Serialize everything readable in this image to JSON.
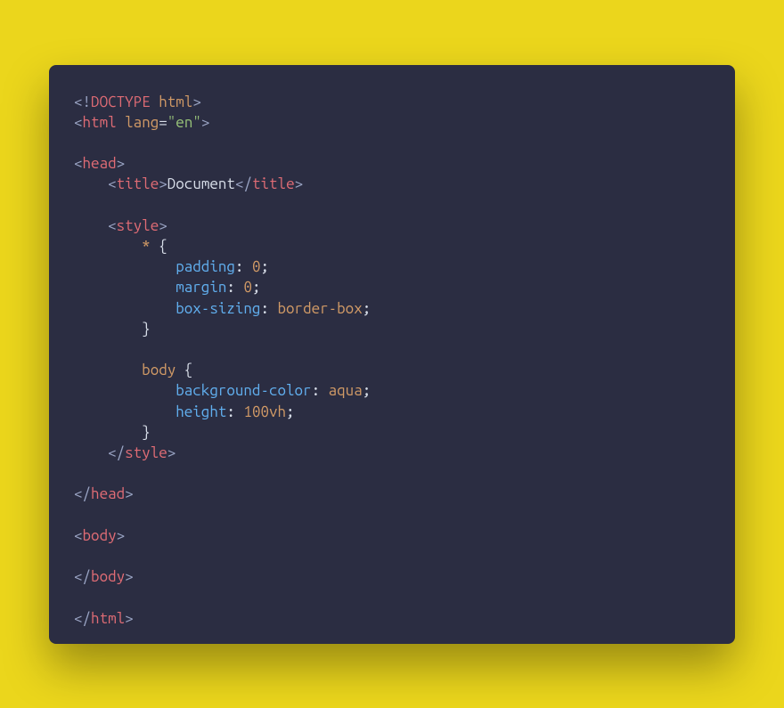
{
  "colors": {
    "page_bg": "#ebd61c",
    "code_bg": "#2b2d42",
    "bracket": "#9aa4c4",
    "tag": "#e06c75",
    "attr_name": "#d19a66",
    "attr_value": "#98c379",
    "text": "#d8dee9",
    "selector": "#d19a66",
    "property": "#61afef",
    "number": "#d19a66",
    "value": "#d19a66"
  },
  "code": {
    "doctype_bang": "<!",
    "doctype_kw": "DOCTYPE",
    "doctype_html": "html",
    "lt": "<",
    "gt": ">",
    "ltc": "</",
    "html_tag": "html",
    "lang_attr": "lang",
    "eq": "=",
    "lang_val": "\"en\"",
    "head_tag": "head",
    "title_tag": "title",
    "title_text": "Document",
    "style_tag": "style",
    "sel_star": "*",
    "brace_open": " {",
    "brace_close": "}",
    "prop_padding": "padding",
    "prop_margin": "margin",
    "prop_boxsizing": "box-sizing",
    "prop_bg": "background-color",
    "prop_height": "height",
    "colon": ":",
    "semi": ";",
    "val_zero": "0",
    "val_borderbox": "border-box",
    "sel_body": "body",
    "val_aqua": "aqua",
    "val_100vh": "100vh",
    "body_tag": "body"
  }
}
